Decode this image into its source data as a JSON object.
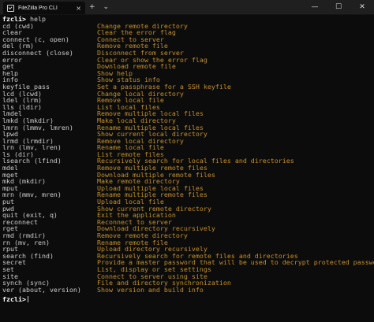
{
  "window": {
    "tab_title": "FileZilla Pro CLI",
    "tab_close": "×",
    "new_tab": "+",
    "dropdown": "⌄",
    "minimize": "—",
    "maximize": "☐",
    "close": "✕"
  },
  "terminal": {
    "prompt": "fzcli>",
    "first_command": " help",
    "commands": [
      {
        "cmd": "cd (cwd)",
        "desc": "Change remote directory"
      },
      {
        "cmd": "clear",
        "desc": "Clear the error flag"
      },
      {
        "cmd": "connect (c, open)",
        "desc": "Connect to server"
      },
      {
        "cmd": "del (rm)",
        "desc": "Remove remote file"
      },
      {
        "cmd": "disconnect (close)",
        "desc": "Disconnect from server"
      },
      {
        "cmd": "error",
        "desc": "Clear or show the error flag"
      },
      {
        "cmd": "get",
        "desc": "Download remote file"
      },
      {
        "cmd": "help",
        "desc": "Show help"
      },
      {
        "cmd": "info",
        "desc": "Show status info"
      },
      {
        "cmd": "keyfile_pass",
        "desc": "Set a passphrase for a SSH keyfile"
      },
      {
        "cmd": "lcd (lcwd)",
        "desc": "Change local directory"
      },
      {
        "cmd": "ldel (lrm)",
        "desc": "Remove local file"
      },
      {
        "cmd": "lls (ldir)",
        "desc": "List local files"
      },
      {
        "cmd": "lmdel",
        "desc": "Remove multiple local files"
      },
      {
        "cmd": "lmkd (lmkdir)",
        "desc": "Make local directory"
      },
      {
        "cmd": "lmrn (lmmv, lmren)",
        "desc": "Rename multiple local files"
      },
      {
        "cmd": "lpwd",
        "desc": "Show current local directory"
      },
      {
        "cmd": "lrmd (lrmdir)",
        "desc": "Remove local directory"
      },
      {
        "cmd": "lrn (lmv, lren)",
        "desc": "Rename local file"
      },
      {
        "cmd": "ls (dir)",
        "desc": "List remote files"
      },
      {
        "cmd": "lsearch (lfind)",
        "desc": "Recursively search for local files and directories"
      },
      {
        "cmd": "mdel",
        "desc": "Remove multiple remote files"
      },
      {
        "cmd": "mget",
        "desc": "Download multiple remote files"
      },
      {
        "cmd": "mkd (mkdir)",
        "desc": "Make remote directory"
      },
      {
        "cmd": "mput",
        "desc": "Upload multiple local files"
      },
      {
        "cmd": "mrn (mmv, mren)",
        "desc": "Rename multiple remote files"
      },
      {
        "cmd": "put",
        "desc": "Upload local file"
      },
      {
        "cmd": "pwd",
        "desc": "Show current remote directory"
      },
      {
        "cmd": "quit (exit, q)",
        "desc": "Exit the application"
      },
      {
        "cmd": "reconnect",
        "desc": "Reconnect to server"
      },
      {
        "cmd": "rget",
        "desc": "Download directory recursively"
      },
      {
        "cmd": "rmd (rmdir)",
        "desc": "Remove remote directory"
      },
      {
        "cmd": "rn (mv, ren)",
        "desc": "Rename remote file"
      },
      {
        "cmd": "rput",
        "desc": "Upload directory recursively"
      },
      {
        "cmd": "search (find)",
        "desc": "Recursively search for remote files and directories"
      },
      {
        "cmd": "secret",
        "desc": "Provide a master password that will be used to decrypt protected password"
      },
      {
        "cmd": "set",
        "desc": "List, display or set settings"
      },
      {
        "cmd": "site",
        "desc": "Connect to server using site"
      },
      {
        "cmd": "synch (sync)",
        "desc": "File and directory synchronization"
      },
      {
        "cmd": "ver (about, version)",
        "desc": "Show version and build info"
      }
    ]
  },
  "colors": {
    "background": "#0c0c0c",
    "command_text": "#cccccc",
    "description_text": "#c69026"
  }
}
